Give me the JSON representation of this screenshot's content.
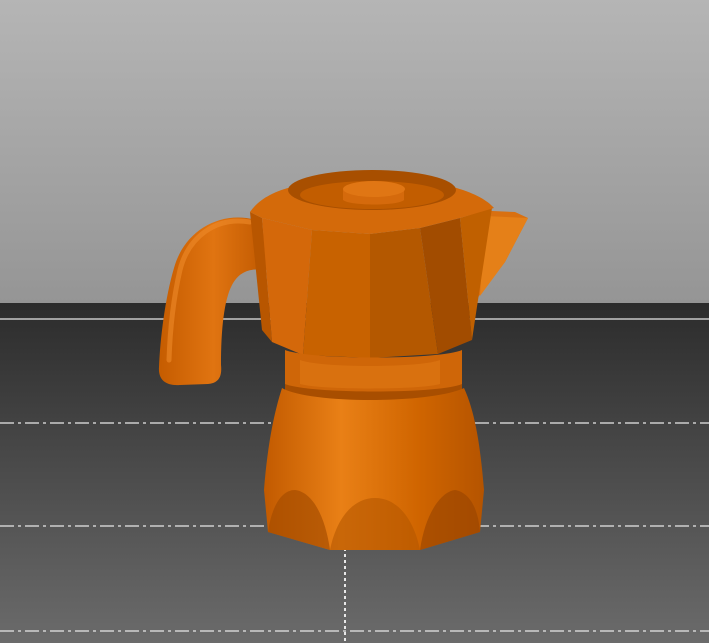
{
  "viewport": {
    "colors": {
      "sky_top": "#b4b4b4",
      "sky_bottom": "#969696",
      "floor_top": "#2e2e2e",
      "floor_bottom": "#6a6a6a",
      "grid_line": "#e8e8e8",
      "model_base": "#c95f00",
      "model_light": "#e57c12",
      "model_dark": "#9c4700"
    },
    "model_icon": "moka-pot-3d-model"
  }
}
